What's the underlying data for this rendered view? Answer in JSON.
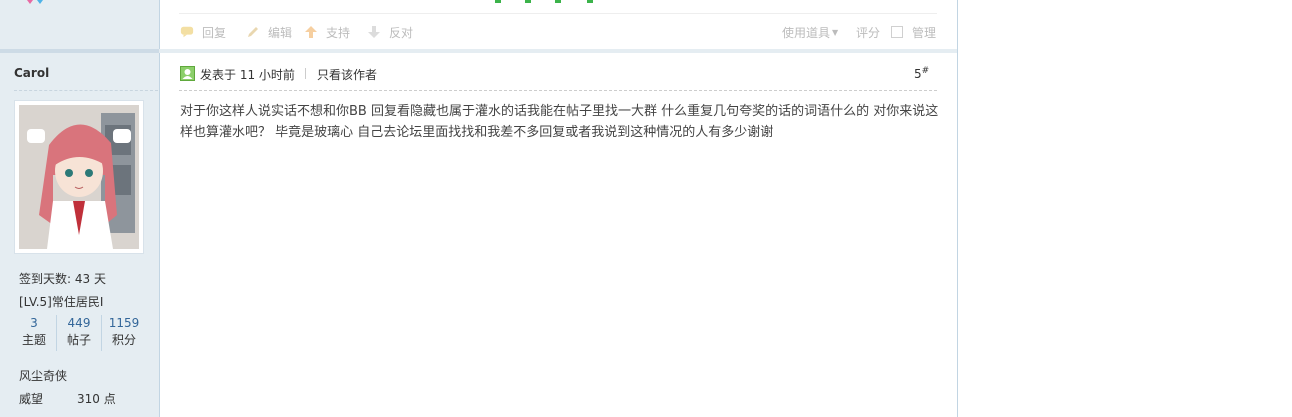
{
  "previous_post": {
    "actions": {
      "reply": "回复",
      "edit": "编辑",
      "support": "支持",
      "oppose": "反对"
    },
    "tools": {
      "use_item": "使用道具",
      "rate": "评分",
      "manage": "管理"
    }
  },
  "author": {
    "name": "Carol",
    "checkin": "签到天数: 43 天",
    "level": "[LV.5]常住居民I",
    "stats": [
      {
        "value": "3",
        "label": "主题"
      },
      {
        "value": "449",
        "label": "帖子"
      },
      {
        "value": "1159",
        "label": "积分"
      }
    ],
    "title": "风尘奇侠",
    "prestige_label": "威望",
    "prestige_value": "310 点"
  },
  "post": {
    "posted_at": "发表于 11 小时前",
    "only_author": "只看该作者",
    "floor": "5",
    "floor_mark": "#",
    "content": "对于你这样人说实话不想和你BB 回复看隐藏也属于灌水的话我能在帖子里找一大群 什么重复几句夸奖的话的词语什么的 对你来说这样也算灌水吧？ 毕竟是玻璃心 自己去论坛里面找找和我差不多回复或者我说到这种情况的人有多少谢谢"
  },
  "colors": {
    "sidebar_bg": "#e5edf2",
    "link": "#336699",
    "muted": "#bcbcbc"
  }
}
